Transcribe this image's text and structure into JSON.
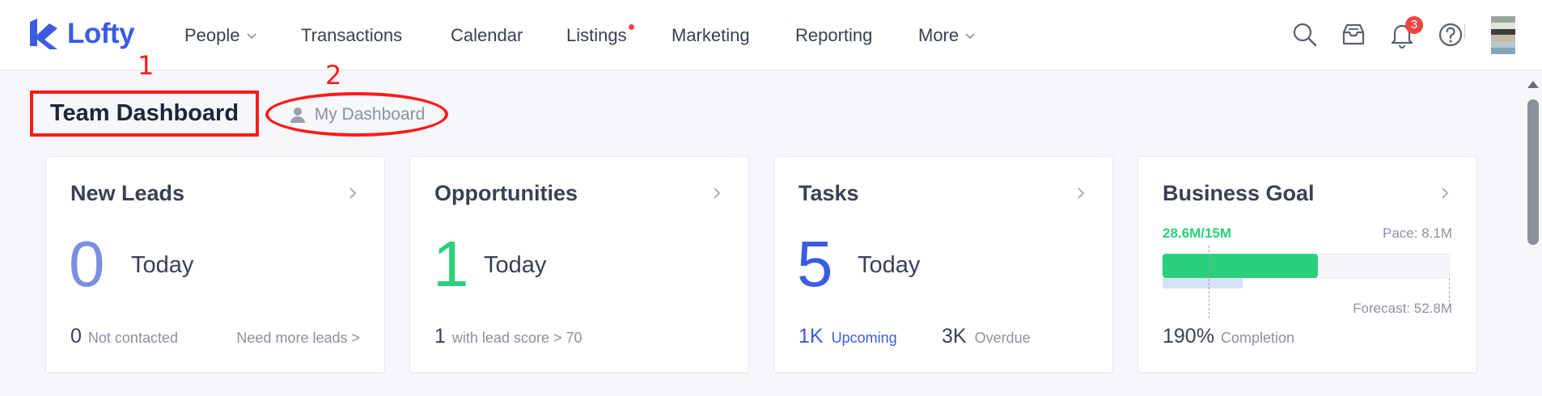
{
  "header": {
    "logo_text": "Lofty",
    "nav": [
      {
        "label": "People",
        "has_dropdown": true
      },
      {
        "label": "Transactions"
      },
      {
        "label": "Calendar"
      },
      {
        "label": "Listings",
        "has_dot": true
      },
      {
        "label": "Marketing"
      },
      {
        "label": "Reporting"
      },
      {
        "label": "More",
        "has_dropdown": true
      }
    ],
    "icons": [
      "search-icon",
      "inbox-icon",
      "bell-icon",
      "help-icon"
    ],
    "notification_count": "3"
  },
  "annotations": {
    "first": "1",
    "second": "2"
  },
  "tabs": {
    "team": "Team Dashboard",
    "mine": "My Dashboard"
  },
  "cards": {
    "new_leads": {
      "title": "New Leads",
      "count": "0",
      "period": "Today",
      "not_contacted_count": "0",
      "not_contacted_label": "Not contacted",
      "link": "Need more leads >"
    },
    "opportunities": {
      "title": "Opportunities",
      "count": "1",
      "period": "Today",
      "score_count": "1",
      "score_label": "with lead score > 70"
    },
    "tasks": {
      "title": "Tasks",
      "count": "5",
      "period": "Today",
      "upcoming_count": "1K",
      "upcoming_label": "Upcoming",
      "overdue_count": "3K",
      "overdue_label": "Overdue"
    },
    "business_goal": {
      "title": "Business Goal",
      "progress_text": "28.6M/15M",
      "pace": "Pace: 8.1M",
      "forecast": "Forecast: 52.8M",
      "completion_value": "190%",
      "completion_label": "Completion",
      "progress_fraction": 0.54,
      "pace_fraction": 0.28
    }
  },
  "colors": {
    "brand": "#3b5ce2",
    "lead_count": "#7b8fe0",
    "opportunity_count": "#2ad07a",
    "task_count": "#3b5ce2",
    "goal_text": "#2ad07a",
    "annotation": "#ff1a1a"
  }
}
